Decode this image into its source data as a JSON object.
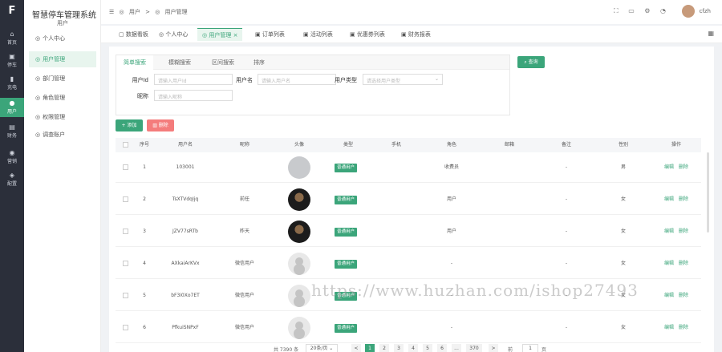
{
  "app": {
    "title": "智慧停车管理系统",
    "subtitle": "用户"
  },
  "rail": [
    {
      "icon": "home-icon",
      "glyph": "⌂",
      "label": "首页"
    },
    {
      "icon": "car-icon",
      "glyph": "▣",
      "label": "停车"
    },
    {
      "icon": "charge-icon",
      "glyph": "▮",
      "label": "充电"
    },
    {
      "icon": "user-icon",
      "glyph": "●",
      "label": "用户"
    },
    {
      "icon": "finance-icon",
      "glyph": "▤",
      "label": "财务"
    },
    {
      "icon": "message-icon",
      "glyph": "◉",
      "label": "营销"
    },
    {
      "icon": "settings-icon",
      "glyph": "◈",
      "label": "配置"
    }
  ],
  "submenu": [
    {
      "label": "个人中心",
      "glyph": "◎"
    },
    {
      "label": "用户管理",
      "glyph": "◎"
    },
    {
      "label": "部门管理",
      "glyph": "◎"
    },
    {
      "label": "角色管理",
      "glyph": "◎"
    },
    {
      "label": "权限管理",
      "glyph": "◎"
    },
    {
      "label": "调查账户",
      "glyph": "◎"
    }
  ],
  "breadcrumb": {
    "first": "用户",
    "sep": ">",
    "second": "用户管理"
  },
  "header_user": "cfzh",
  "tabs": [
    {
      "label": "数据看板",
      "glyph": "▢"
    },
    {
      "label": "个人中心",
      "glyph": "◎"
    },
    {
      "label": "用户管理",
      "glyph": "◎"
    },
    {
      "label": "订单列表",
      "glyph": "▣"
    },
    {
      "label": "活动列表",
      "glyph": "▣"
    },
    {
      "label": "优惠券列表",
      "glyph": "▣"
    },
    {
      "label": "财务报表",
      "glyph": "▣"
    }
  ],
  "search": {
    "tabs": [
      "简单搜索",
      "模糊搜索",
      "区间搜索",
      "排序"
    ],
    "fields": {
      "user_id": {
        "label": "用户Id",
        "placeholder": "请输入用户Id"
      },
      "username": {
        "label": "用户名",
        "placeholder": "请输入用户名"
      },
      "user_type": {
        "label": "用户类型",
        "placeholder": "请选择用户类型"
      },
      "nickname": {
        "label": "昵称",
        "placeholder": "请输入昵称"
      }
    },
    "button": "查询"
  },
  "actions": {
    "add": "+ 添加",
    "delete": "删除"
  },
  "table": {
    "columns": [
      "序号",
      "用户名",
      "昵称",
      "头像",
      "类型",
      "手机",
      "角色",
      "邮箱",
      "备注",
      "性别",
      "操作"
    ],
    "rows": [
      {
        "index": "1",
        "username": "103001",
        "nickname": "",
        "avatar": "grey",
        "type": "普通用户",
        "phone": "",
        "role": "收费员",
        "email": "",
        "remark": "-",
        "gender": "男"
      },
      {
        "index": "2",
        "username": "TsXTVdqIjq",
        "nickname": "前任",
        "avatar": "dark",
        "type": "普通用户",
        "phone": "",
        "role": "用户",
        "email": "",
        "remark": "-",
        "gender": "女"
      },
      {
        "index": "3",
        "username": "JZV77sRTb",
        "nickname": "昨天",
        "avatar": "dark",
        "type": "普通用户",
        "phone": "",
        "role": "用户",
        "email": "",
        "remark": "-",
        "gender": "女"
      },
      {
        "index": "4",
        "username": "AXkaiArKVx",
        "nickname": "微信用户",
        "avatar": "light",
        "type": "普通用户",
        "phone": "",
        "role": "-",
        "email": "",
        "remark": "-",
        "gender": "女"
      },
      {
        "index": "5",
        "username": "bF3i0Xo7ET",
        "nickname": "微信用户",
        "avatar": "light",
        "type": "普通用户",
        "phone": "",
        "role": "-",
        "email": "",
        "remark": "-",
        "gender": "女"
      },
      {
        "index": "6",
        "username": "PfkuiSNPxF",
        "nickname": "微信用户",
        "avatar": "light",
        "type": "普通用户",
        "phone": "",
        "role": "-",
        "email": "",
        "remark": "-",
        "gender": "女"
      }
    ],
    "op_edit": "编辑",
    "op_delete": "删除"
  },
  "pagination": {
    "total": "共 7390 条",
    "page_size": "20条/页",
    "prev": "<",
    "pages": [
      "1",
      "2",
      "3",
      "4",
      "5",
      "6",
      "...",
      "370"
    ],
    "next": ">",
    "goto_label": "前往",
    "goto_value": "1",
    "goto_unit": "页"
  },
  "watermark": "https://www.huzhan.com/ishop27493",
  "colors": {
    "accent": "#3ba57a",
    "danger": "#f47c7c",
    "rail": "#2b2f3a"
  }
}
